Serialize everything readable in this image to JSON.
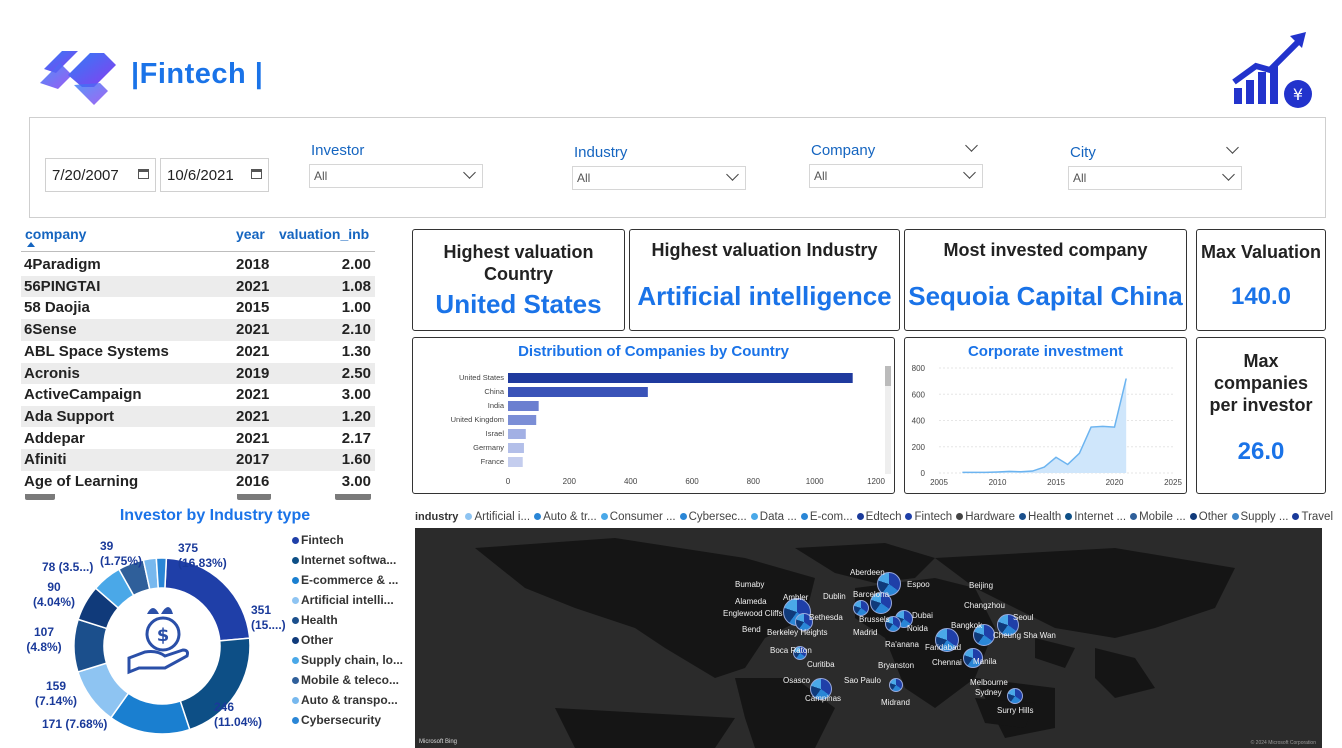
{
  "header": {
    "title": "|Fintech |"
  },
  "filters": {
    "start_date": "7/20/2007",
    "end_date": "10/6/2021",
    "investor": {
      "label": "Investor",
      "value": "All"
    },
    "industry": {
      "label": "Industry",
      "value": "All"
    },
    "company": {
      "label": "Company",
      "value": "All"
    },
    "city": {
      "label": "City",
      "value": "All"
    }
  },
  "table": {
    "columns": [
      "company",
      "year",
      "valuation_inb"
    ],
    "rows": [
      [
        "4Paradigm",
        "2018",
        "2.00"
      ],
      [
        "56PINGTAI",
        "2021",
        "1.08"
      ],
      [
        "58 Daojia",
        "2015",
        "1.00"
      ],
      [
        "6Sense",
        "2021",
        "2.10"
      ],
      [
        "ABL Space Systems",
        "2021",
        "1.30"
      ],
      [
        "Acronis",
        "2019",
        "2.50"
      ],
      [
        "ActiveCampaign",
        "2021",
        "3.00"
      ],
      [
        "Ada Support",
        "2021",
        "1.20"
      ],
      [
        "Addepar",
        "2021",
        "2.17"
      ],
      [
        "Afiniti",
        "2017",
        "1.60"
      ],
      [
        "Age of Learning",
        "2016",
        "3.00"
      ]
    ]
  },
  "cards": {
    "highest_country": {
      "title": "Highest valuation Country",
      "value": "United States"
    },
    "highest_industry": {
      "title": "Highest valuation Industry",
      "value": "Artificial intelligence"
    },
    "most_invested": {
      "title": "Most invested company",
      "value": "Sequoia Capital China"
    },
    "max_valuation": {
      "title": "Max Valuation",
      "value": "140.0"
    },
    "max_companies": {
      "title": "Max companies per investor",
      "value": "26.0"
    }
  },
  "colors": {
    "accent": "#1a73e8",
    "bar_dark": "#1f3a9e",
    "map_bg": "#2b2b2b"
  },
  "chart_data": [
    {
      "type": "bar",
      "title": "Distribution of Companies by Country",
      "categories": [
        "United States",
        "China",
        "India",
        "United Kingdom",
        "Israel",
        "Germany",
        "France"
      ],
      "values": [
        1124,
        456,
        100,
        92,
        58,
        52,
        48
      ],
      "xlim": [
        0,
        1200
      ],
      "xticks": [
        "0",
        "200",
        "400",
        "600",
        "800",
        "1000",
        "1200"
      ]
    },
    {
      "type": "area",
      "title": "Corporate investment",
      "x": [
        2007,
        2008,
        2009,
        2010,
        2011,
        2012,
        2013,
        2014,
        2015,
        2016,
        2017,
        2018,
        2019,
        2020,
        2021
      ],
      "values": [
        5,
        5,
        5,
        8,
        12,
        10,
        15,
        45,
        120,
        65,
        150,
        350,
        355,
        350,
        720
      ],
      "xlim": [
        2005,
        2025
      ],
      "ylim": [
        0,
        800
      ],
      "xticks": [
        "2005",
        "2010",
        "2015",
        "2020",
        "2025"
      ],
      "yticks": [
        "0",
        "200",
        "400",
        "600",
        "800"
      ]
    },
    {
      "type": "pie",
      "title": "Investor by Industry type",
      "categories": [
        "Fintech",
        "Internet softwa...",
        "E-commerce & ...",
        "Artificial intelli...",
        "Health",
        "Other",
        "Supply chain, lo...",
        "Mobile & teleco...",
        "Auto & transpo...",
        "Cybersecurity"
      ],
      "values": [
        375,
        351,
        246,
        171,
        159,
        107,
        90,
        78,
        39,
        30
      ],
      "labels": [
        "375\n(16.83%)",
        "351\n(15....)",
        "246\n(11.04%)",
        "171 (7.68%)",
        "159\n(7.14%)",
        "107\n(4.8%)",
        "90\n(4.04%)",
        "78 (3.5...)",
        "39\n(1.75%)",
        ""
      ],
      "colors": [
        "#1f3fa8",
        "#0d4f86",
        "#1a7fd0",
        "#8ec4f2",
        "#1b4f8c",
        "#103a7a",
        "#4aa8e8",
        "#2f5f9a",
        "#77b8ee",
        "#2a86d6"
      ]
    }
  ],
  "map": {
    "legend_title": "industry",
    "legend": [
      "Artificial i...",
      "Auto & tr...",
      "Consumer ...",
      "Cybersec...",
      "Data ...",
      "E-com...",
      "Edtech",
      "Fintech",
      "Hardware",
      "Health",
      "Internet ...",
      "Mobile ...",
      "Other",
      "Supply ...",
      "Travel"
    ],
    "legend_colors": [
      "#8ec4f2",
      "#2a86d6",
      "#4aa8e8",
      "#2a86d6",
      "#4aa8e8",
      "#2a86d6",
      "#1a3a9a",
      "#1f3fa8",
      "#444444",
      "#1b4f8c",
      "#0d4f86",
      "#2f5f9a",
      "#103a7a",
      "#3f86c9",
      "#1a3a9a"
    ],
    "cities": [
      "Aberdeen",
      "Espoo",
      "Beijing",
      "Bumaby",
      "Ambler",
      "Dublin",
      "Barcelona",
      "Alameda",
      "Englewood Cliffs",
      "Bethesda",
      "Brussels",
      "Dubai",
      "Changzhou",
      "Seoul",
      "Bend",
      "Berkeley Heights",
      "Madrid",
      "Noida",
      "Bangkok",
      "Cheung Sha Wan",
      "Ra'anana",
      "Faridabad",
      "Boca Raton",
      "Chennai",
      "Manila",
      "Curitiba",
      "Bryanston",
      "Osasco",
      "Sao Paulo",
      "Melbourne",
      "Campinas",
      "Midrand",
      "Sydney",
      "Surry Hills"
    ],
    "attribution": "Microsoft Bing",
    "copyright": "© 2024 Microsoft Corporation"
  }
}
